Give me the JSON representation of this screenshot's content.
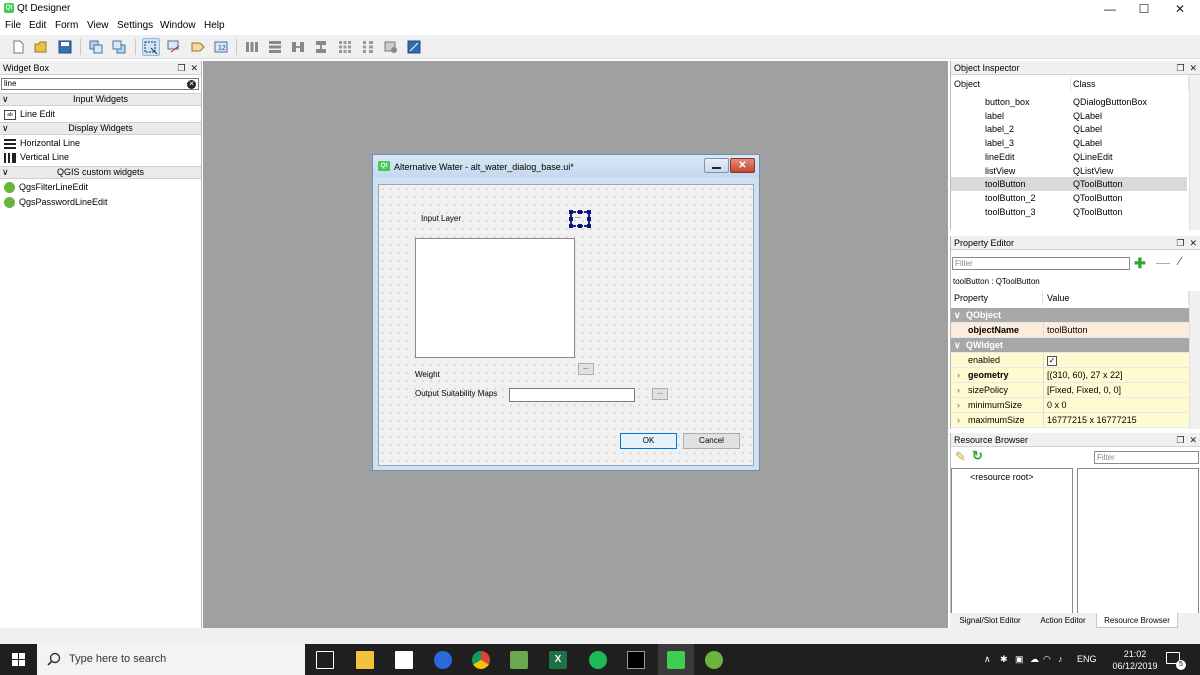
{
  "window": {
    "title": "Qt Designer",
    "min": "—",
    "max": "☐",
    "close": "✕"
  },
  "menu": [
    "File",
    "Edit",
    "Form",
    "View",
    "Settings",
    "Window",
    "Help"
  ],
  "widget_box": {
    "title": "Widget Box",
    "search_value": "line",
    "categories": [
      {
        "label": "Input Widgets",
        "items": [
          "Line Edit"
        ]
      },
      {
        "label": "Display Widgets",
        "items": [
          "Horizontal Line",
          "Vertical Line"
        ]
      },
      {
        "label": "QGIS custom widgets",
        "items": [
          "QgsFilterLineEdit",
          "QgsPasswordLineEdit"
        ]
      }
    ]
  },
  "dialog": {
    "title": "Alternative Water - alt_water_dialog_base.ui*",
    "input_layer_label": "Input Layer",
    "weight_label": "Weight",
    "output_label": "Output Suitability Maps",
    "browse": "...",
    "ok": "OK",
    "cancel": "Cancel"
  },
  "object_inspector": {
    "title": "Object Inspector",
    "col_object": "Object",
    "col_class": "Class",
    "rows": [
      {
        "object": "button_box",
        "class": "QDialogButtonBox"
      },
      {
        "object": "label",
        "class": "QLabel"
      },
      {
        "object": "label_2",
        "class": "QLabel"
      },
      {
        "object": "label_3",
        "class": "QLabel"
      },
      {
        "object": "lineEdit",
        "class": "QLineEdit"
      },
      {
        "object": "listView",
        "class": "QListView"
      },
      {
        "object": "toolButton",
        "class": "QToolButton",
        "selected": true
      },
      {
        "object": "toolButton_2",
        "class": "QToolButton"
      },
      {
        "object": "toolButton_3",
        "class": "QToolButton"
      }
    ]
  },
  "property_editor": {
    "title": "Property Editor",
    "filter_placeholder": "Filter",
    "caption": "toolButton : QToolButton",
    "col_property": "Property",
    "col_value": "Value",
    "rows": [
      {
        "group": "QObject"
      },
      {
        "name": "objectName",
        "value": "toolButton",
        "bold": true,
        "kind": "obj"
      },
      {
        "group": "QWidget"
      },
      {
        "name": "enabled",
        "value": "✓",
        "kind": "wid"
      },
      {
        "name": "geometry",
        "value": "[(310, 60), 27 x 22]",
        "bold": true,
        "kind": "wid",
        "expand": true
      },
      {
        "name": "sizePolicy",
        "value": "[Fixed, Fixed, 0, 0]",
        "kind": "wid",
        "expand": true
      },
      {
        "name": "minimumSize",
        "value": "0 x 0",
        "kind": "wid",
        "expand": true
      },
      {
        "name": "maximumSize",
        "value": "16777215 x 16777215",
        "kind": "wid",
        "expand": true
      }
    ]
  },
  "resource_browser": {
    "title": "Resource Browser",
    "filter_placeholder": "Filter",
    "root": "<resource root>"
  },
  "dock_tabs": [
    "Signal/Slot Editor",
    "Action Editor",
    "Resource Browser"
  ],
  "taskbar": {
    "search_placeholder": "Type here to search",
    "language": "ENG",
    "time": "21:02",
    "date": "06/12/2019",
    "notifications": "5"
  },
  "colors": {
    "accent": "#0078d7",
    "qt_green": "#41cd52",
    "workspace": "#a0a0a0"
  }
}
